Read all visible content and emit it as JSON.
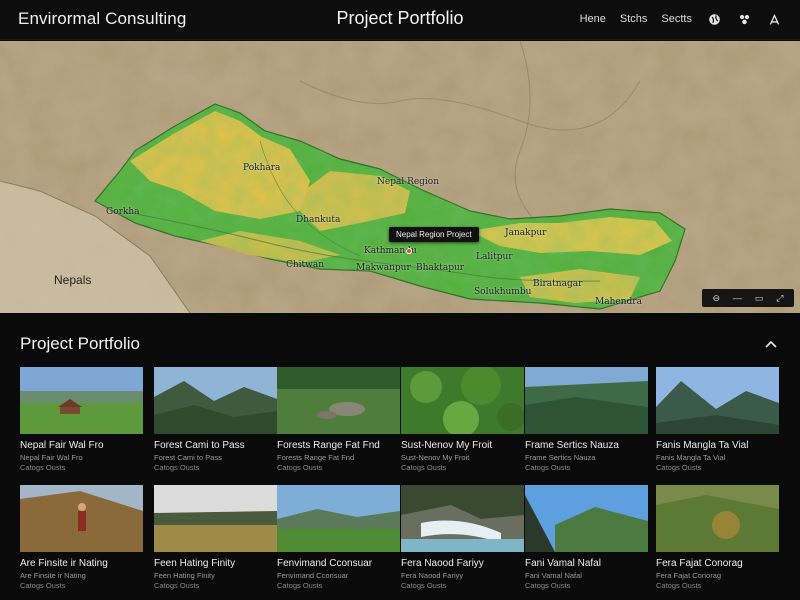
{
  "header": {
    "brand": "Envirormal Consulting",
    "title": "Project Portfolio",
    "nav": [
      "Hene",
      "Stchs",
      "Sectts"
    ],
    "icons": [
      "globe-icon",
      "settings-icon",
      "user-icon"
    ]
  },
  "map": {
    "country_label": "Nepals",
    "tooltip": "Nepal Region Project",
    "region_labels": [
      "Pokhara",
      "Nepal Region",
      "Gorkha",
      "Kathmandu",
      "Dhankuta",
      "Chitwan",
      "Makwanpur",
      "Bhaktapur",
      "Lalitpur",
      "Janakpur",
      "Biratnagar",
      "Solukhumbu",
      "Mahendra"
    ],
    "controls": [
      "zoom-out",
      "layers",
      "scale",
      "fullscreen"
    ]
  },
  "section": {
    "title": "Project Portfolio"
  },
  "cards": [
    {
      "title": "Nepal Fair Wal Fro",
      "meta": "Nepal Fair Wal Fro",
      "meta2": "Catogs  Ousts"
    },
    {
      "title": "Forest Cami to Pass",
      "meta": "Forest Cami to Pass",
      "meta2": "Catogs  Ousts"
    },
    {
      "title": "Forests Range Fat Fnd",
      "meta": "Forests Range Fat Fnd",
      "meta2": "Catogs  Ousts"
    },
    {
      "title": "Sust-Nenov My Froit",
      "meta": "Sust-Nenov My Froit",
      "meta2": "Catogs  Ousts"
    },
    {
      "title": "Frame Sertics Nauza",
      "meta": "Frame Sertics Nauza",
      "meta2": "Catogs  Ousts"
    },
    {
      "title": "Fanis Mangla Ta Vial",
      "meta": "Fanis Mangla Ta Vial",
      "meta2": "Catogs  Ousts"
    },
    {
      "title": "Are Finsite ir Nating",
      "meta": "Are Finsite ir Nating",
      "meta2": "Catogs  Ousts"
    },
    {
      "title": "Feen Hating Finity",
      "meta": "Feen Hating Finity",
      "meta2": "Catogs  Ousts"
    },
    {
      "title": "Fenvimand Cconsuar",
      "meta": "Fenvimand Cconsuar",
      "meta2": "Catogs  Ousts"
    },
    {
      "title": "Fera Naood Fariyy",
      "meta": "Fera Naood Fariyy",
      "meta2": "Catogs  Ousts"
    },
    {
      "title": "Fani Vamal Nafal",
      "meta": "Fani Vamal Nafal",
      "meta2": "Catogs  Ousts"
    },
    {
      "title": "Fera Fajat Conorag",
      "meta": "Fera Fajat Conorag",
      "meta2": "Catogs  Ousts"
    }
  ],
  "colors": {
    "background": "#0b0b0b",
    "terrain": "#a89572",
    "forest": "#4fae3a",
    "highland": "#e9c24a",
    "marker": "#e04a2a"
  }
}
